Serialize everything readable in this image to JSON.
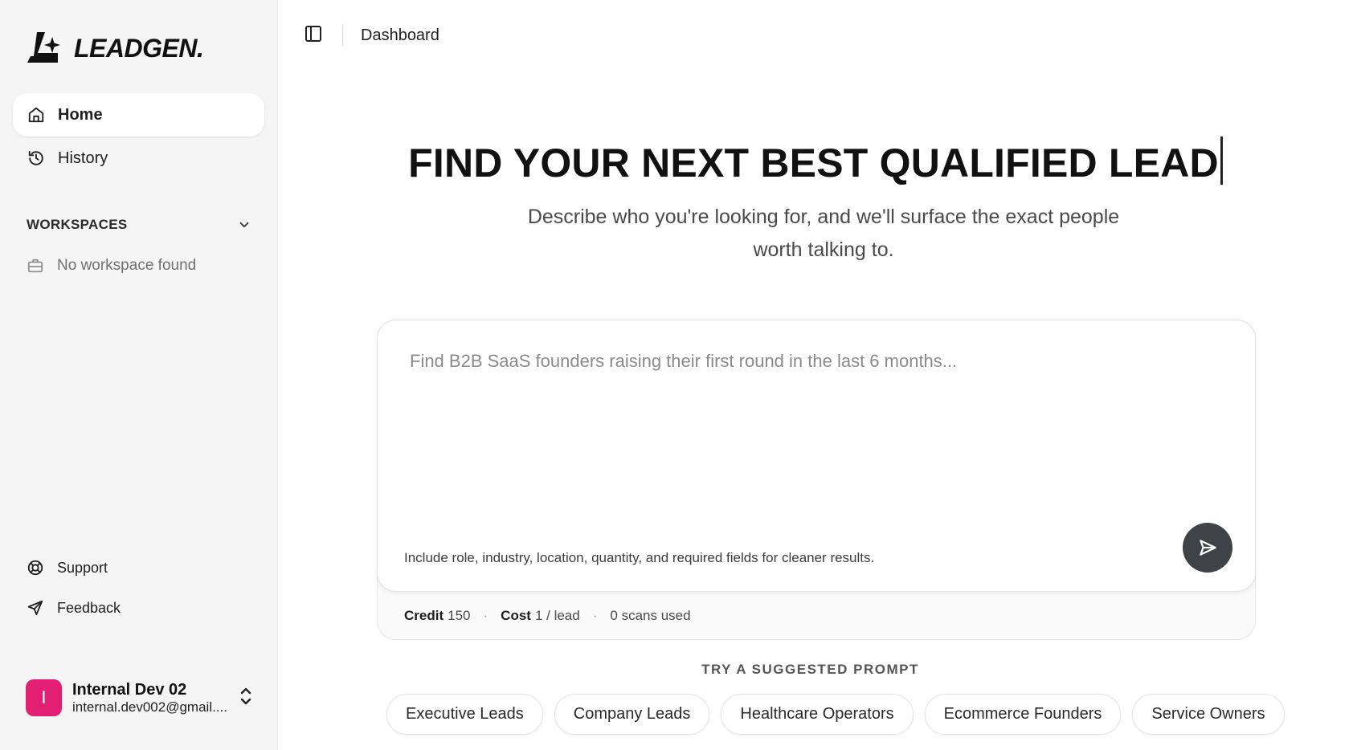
{
  "brand": {
    "name": "LEADGEN."
  },
  "sidebar": {
    "nav": [
      {
        "label": "Home",
        "icon": "home-icon",
        "active": true
      },
      {
        "label": "History",
        "icon": "history-icon",
        "active": false
      }
    ],
    "workspaces": {
      "title": "WORKSPACES",
      "empty_label": "No workspace found"
    },
    "bottom": [
      {
        "label": "Support",
        "icon": "lifebuoy-icon"
      },
      {
        "label": "Feedback",
        "icon": "send-icon"
      }
    ],
    "user": {
      "initial": "I",
      "name": "Internal Dev 02",
      "email": "internal.dev002@gmail...."
    }
  },
  "topbar": {
    "breadcrumb": "Dashboard"
  },
  "hero": {
    "title": "FIND YOUR NEXT BEST QUALIFIED LEAD",
    "subtitle": "Describe who you're looking for, and we'll surface the exact people worth talking to."
  },
  "composer": {
    "placeholder": "Find B2B SaaS founders raising their first round in the last 6 months...",
    "value": "",
    "hint": "Include role, industry, location, quantity, and required fields for cleaner results."
  },
  "meta": {
    "credit_label": "Credit",
    "credit_value": "150",
    "cost_label": "Cost",
    "cost_value": "1 / lead",
    "scans": "0 scans used",
    "separator": "·"
  },
  "suggestions": {
    "title": "TRY A SUGGESTED PROMPT",
    "chips": [
      "Executive Leads",
      "Company Leads",
      "Healthcare Operators",
      "Ecommerce Founders",
      "Service Owners"
    ]
  },
  "colors": {
    "sidebar_bg": "#f5f5f6",
    "avatar": "#e21f72",
    "send_button": "#3f4348"
  }
}
